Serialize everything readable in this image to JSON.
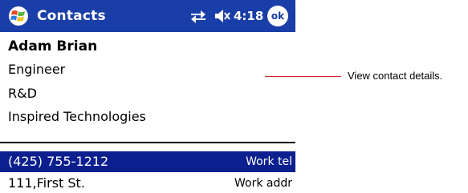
{
  "titlebar": {
    "app_title": "Contacts",
    "time": "4:18",
    "ok_label": "ok",
    "icons": {
      "start": "windows-flag-icon",
      "connectivity": "connectivity-arrows-icon",
      "volume": "speaker-muted-icon"
    },
    "colors": {
      "bar": "#1a3ea8",
      "text": "#ffffff"
    }
  },
  "contact": {
    "name": "Adam Brian",
    "job_title": "Engineer",
    "department": "R&D",
    "company": "Inspired Technologies"
  },
  "fields": [
    {
      "value": "(425) 755-1212",
      "label": "Work tel",
      "selected": true
    },
    {
      "value": "111,First St.",
      "label": "Work addr",
      "selected": false
    }
  ],
  "annotation": {
    "text": "View contact details.",
    "line_color": "#d2232a"
  },
  "colors": {
    "selection": "#0b1f8f"
  }
}
